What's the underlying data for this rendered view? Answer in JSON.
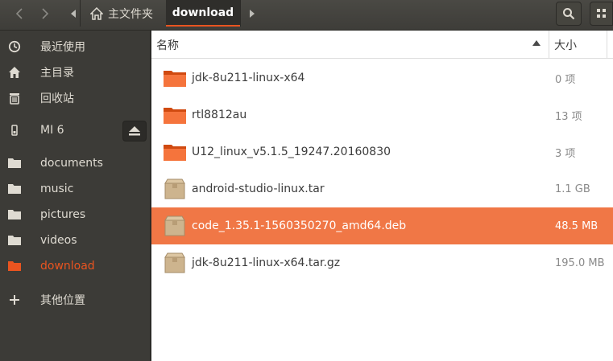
{
  "header": {
    "path_home": "主文件夹",
    "path_current": "download"
  },
  "sidebar": {
    "items": [
      {
        "label": "最近使用",
        "icon": "clock-icon"
      },
      {
        "label": "主目录",
        "icon": "home-icon"
      },
      {
        "label": "回收站",
        "icon": "trash-icon"
      },
      {
        "label": "MI 6",
        "icon": "phone-icon"
      },
      {
        "label": "documents",
        "icon": "folder-icon"
      },
      {
        "label": "music",
        "icon": "folder-icon"
      },
      {
        "label": "pictures",
        "icon": "folder-icon"
      },
      {
        "label": "videos",
        "icon": "folder-icon"
      },
      {
        "label": "download",
        "icon": "folder-icon",
        "active": true
      },
      {
        "label": "其他位置",
        "icon": "plus-icon"
      }
    ]
  },
  "columns": {
    "name": "名称",
    "size": "大小"
  },
  "files": [
    {
      "name": "jdk-8u211-linux-x64",
      "size": "0 项",
      "type": "folder"
    },
    {
      "name": "rtl8812au",
      "size": "13 项",
      "type": "folder"
    },
    {
      "name": "U12_linux_v5.1.5_19247.20160830",
      "size": "3 项",
      "type": "folder"
    },
    {
      "name": "android-studio-linux.tar",
      "size": "1.1 GB",
      "type": "archive"
    },
    {
      "name": "code_1.35.1-1560350270_amd64.deb",
      "size": "48.5 MB",
      "type": "archive",
      "selected": true
    },
    {
      "name": "jdk-8u211-linux-x64.tar.gz",
      "size": "195.0 MB",
      "type": "archive"
    }
  ],
  "colors": {
    "accent": "#e95420",
    "selection": "#f07746",
    "sidebar_bg": "#3c3b37"
  }
}
